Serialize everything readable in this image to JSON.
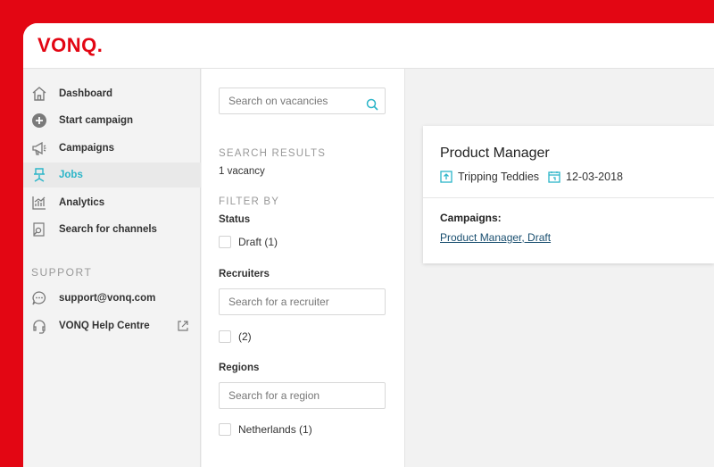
{
  "brand": {
    "logo_text": "VONQ.",
    "accent": "#e30613",
    "active_color": "#2bb5c8"
  },
  "sidebar": {
    "items": [
      {
        "label": "Dashboard",
        "icon": "home-icon"
      },
      {
        "label": "Start campaign",
        "icon": "plus-circle-icon"
      },
      {
        "label": "Campaigns",
        "icon": "megaphone-icon"
      },
      {
        "label": "Jobs",
        "icon": "chair-icon",
        "active": true
      },
      {
        "label": "Analytics",
        "icon": "chart-icon"
      },
      {
        "label": "Search for channels",
        "icon": "search-channels-icon"
      }
    ],
    "support_title": "SUPPORT",
    "support_items": [
      {
        "label": "support@vonq.com",
        "icon": "chat-icon"
      },
      {
        "label": "VONQ Help Centre",
        "icon": "headset-icon",
        "trailing_icon": "external-link-icon"
      }
    ]
  },
  "filters": {
    "search_placeholder": "Search on vacancies",
    "results_title": "SEARCH RESULTS",
    "results_count": "1 vacancy",
    "filter_title": "FILTER BY",
    "status_label": "Status",
    "status_option": "Draft (1)",
    "recruiters_label": "Recruiters",
    "recruiter_placeholder": "Search for a recruiter",
    "recruiter_option": "(2)",
    "regions_label": "Regions",
    "region_placeholder": "Search for a region",
    "region_option": "Netherlands (1)"
  },
  "job_card": {
    "title": "Product Manager",
    "company": "Tripping Teddies",
    "date": "12-03-2018",
    "campaigns_label": "Campaigns:",
    "campaign_link": "Product Manager, Draft"
  }
}
